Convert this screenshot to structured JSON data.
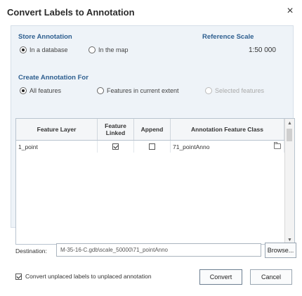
{
  "window": {
    "title": "Convert Labels to Annotation",
    "close_glyph": "×"
  },
  "store": {
    "heading": "Store Annotation",
    "options": [
      {
        "label": "In a database",
        "selected": true
      },
      {
        "label": "In the map",
        "selected": false
      }
    ]
  },
  "reference_scale": {
    "heading": "Reference Scale",
    "value": "1:50 000"
  },
  "create_for": {
    "heading": "Create Annotation For",
    "options": [
      {
        "label": "All features",
        "selected": true,
        "enabled": true
      },
      {
        "label": "Features in current extent",
        "selected": false,
        "enabled": true
      },
      {
        "label": "Selected features",
        "selected": false,
        "enabled": false
      }
    ]
  },
  "table": {
    "columns": [
      "Feature Layer",
      "Feature\nLinked",
      "Append",
      "Annotation Feature Class"
    ],
    "rows": [
      {
        "feature_layer": "1_point",
        "feature_linked": true,
        "append": false,
        "annotation_feature_class": "71_pointAnno"
      }
    ]
  },
  "destination": {
    "label": "Destination:",
    "value": "M-35-16-C.gdb\\scale_50000\\71_pointAnno",
    "browse_label": "Browse..."
  },
  "unplaced": {
    "label": "Convert unplaced labels to unplaced annotation",
    "checked": true
  },
  "buttons": {
    "convert": "Convert",
    "cancel": "Cancel"
  },
  "colors": {
    "panel_bg": "#eef3f8",
    "heading_blue": "#2d5e8f"
  }
}
